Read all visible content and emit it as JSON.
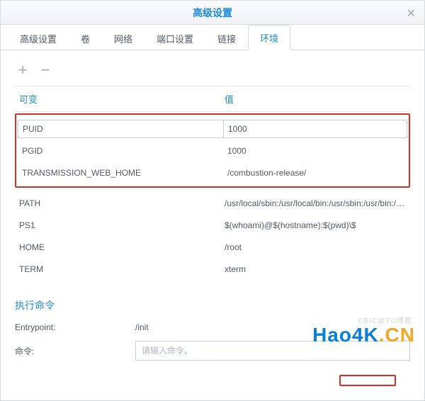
{
  "header": {
    "title": "高级设置"
  },
  "tabs": [
    {
      "label": "高级设置",
      "active": false
    },
    {
      "label": "卷",
      "active": false
    },
    {
      "label": "网络",
      "active": false
    },
    {
      "label": "端口设置",
      "active": false
    },
    {
      "label": "链接",
      "active": false
    },
    {
      "label": "环境",
      "active": true
    }
  ],
  "table": {
    "headers": {
      "key": "可变",
      "value": "值"
    },
    "highlighted_rows": [
      {
        "key": "PUID",
        "value": "1000",
        "editing": true
      },
      {
        "key": "PGID",
        "value": "1000",
        "editing": false
      },
      {
        "key": "TRANSMISSION_WEB_HOME",
        "value": "/combustion-release/",
        "editing": false
      }
    ],
    "rows": [
      {
        "key": "PATH",
        "value": "/usr/local/sbin:/usr/local/bin:/usr/sbin:/usr/bin:/sbin:/bin"
      },
      {
        "key": "PS1",
        "value": "$(whoami)@$(hostname):$(pwd)\\$"
      },
      {
        "key": "HOME",
        "value": "/root"
      },
      {
        "key": "TERM",
        "value": "xterm"
      }
    ]
  },
  "exec": {
    "title": "执行命令",
    "entrypoint_label": "Entrypoint:",
    "entrypoint_value": "/init",
    "cmd_label": "命令:",
    "cmd_placeholder": "请输入命令。"
  },
  "watermark": {
    "text1": "Hao4K",
    "text2": ".CN",
    "small": "©BIC@TO博客"
  }
}
